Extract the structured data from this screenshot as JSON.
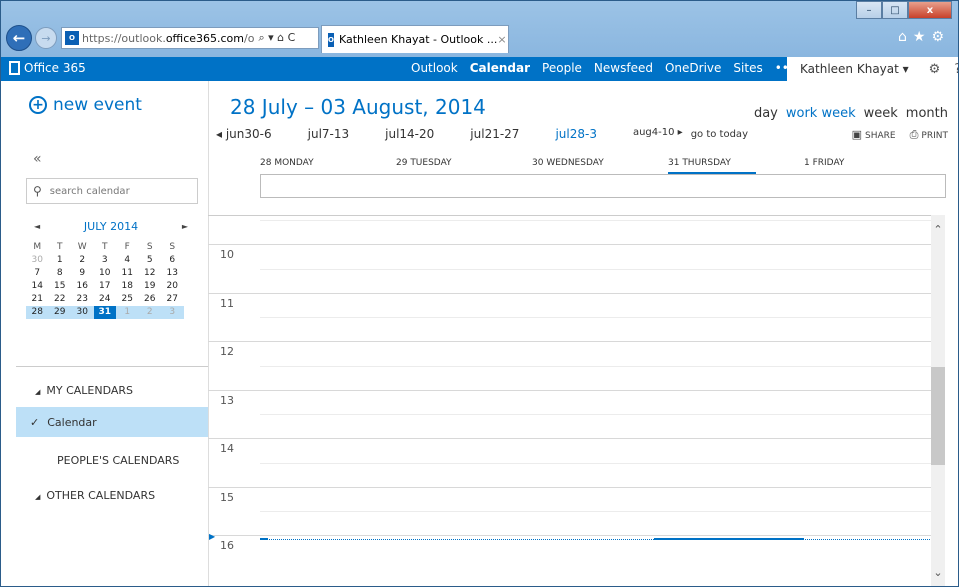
{
  "browser": {
    "url_prefix": "https://outlook.",
    "url_domain": "office365.com",
    "url_suffix": "/o",
    "address_tools": "⌕ ▾ ⌂ C",
    "tab_title": "Kathleen Khayat - Outlook ...",
    "tab_close": "×",
    "ie_tools": "⌂★⚙",
    "win_min": "–",
    "win_max": "□",
    "win_close": "x"
  },
  "header": {
    "product": "Office 365",
    "nav": [
      "Outlook",
      "Calendar",
      "People",
      "Newsfeed",
      "OneDrive",
      "Sites",
      "•••"
    ],
    "active_nav": "Calendar",
    "user": "Kathleen Khayat ▾",
    "settings_icon": "⚙",
    "help": "?"
  },
  "left": {
    "new_event_label": "new event",
    "collapse_glyph": "«",
    "search_placeholder": "search calendar",
    "minical": {
      "month": "JULY 2014",
      "prev": "◄",
      "next": "►",
      "dow": [
        "M",
        "T",
        "W",
        "T",
        "F",
        "S",
        "S"
      ],
      "weeks": [
        [
          "30",
          "1",
          "2",
          "3",
          "4",
          "5",
          "6"
        ],
        [
          "7",
          "8",
          "9",
          "10",
          "11",
          "12",
          "13"
        ],
        [
          "14",
          "15",
          "16",
          "17",
          "18",
          "19",
          "20"
        ],
        [
          "21",
          "22",
          "23",
          "24",
          "25",
          "26",
          "27"
        ],
        [
          "28",
          "29",
          "30",
          "31",
          "1",
          "2",
          "3"
        ]
      ]
    },
    "my_calendars": "MY CALENDARS",
    "calendar_item": "Calendar",
    "peoples_calendars": "PEOPLE'S CALENDARS",
    "other_calendars": "OTHER CALENDARS"
  },
  "main": {
    "date_range": "28 July – 03 August, 2014",
    "views": [
      "day",
      "work week",
      "week",
      "month"
    ],
    "active_view": "work week",
    "weeks": [
      "◂ jun30-6",
      "jul7-13",
      "jul14-20",
      "jul21-27",
      "jul28-3",
      "aug4-10 ▸"
    ],
    "active_week": "jul28-3",
    "go_to_today": "go to today",
    "share": "SHARE",
    "print": "PRINT",
    "days": [
      "28 MONDAY",
      "29 TUESDAY",
      "30 WEDNESDAY",
      "31 THURSDAY",
      "1 FRIDAY"
    ],
    "hours": [
      "10",
      "11",
      "12",
      "13",
      "14",
      "15",
      "16"
    ]
  }
}
